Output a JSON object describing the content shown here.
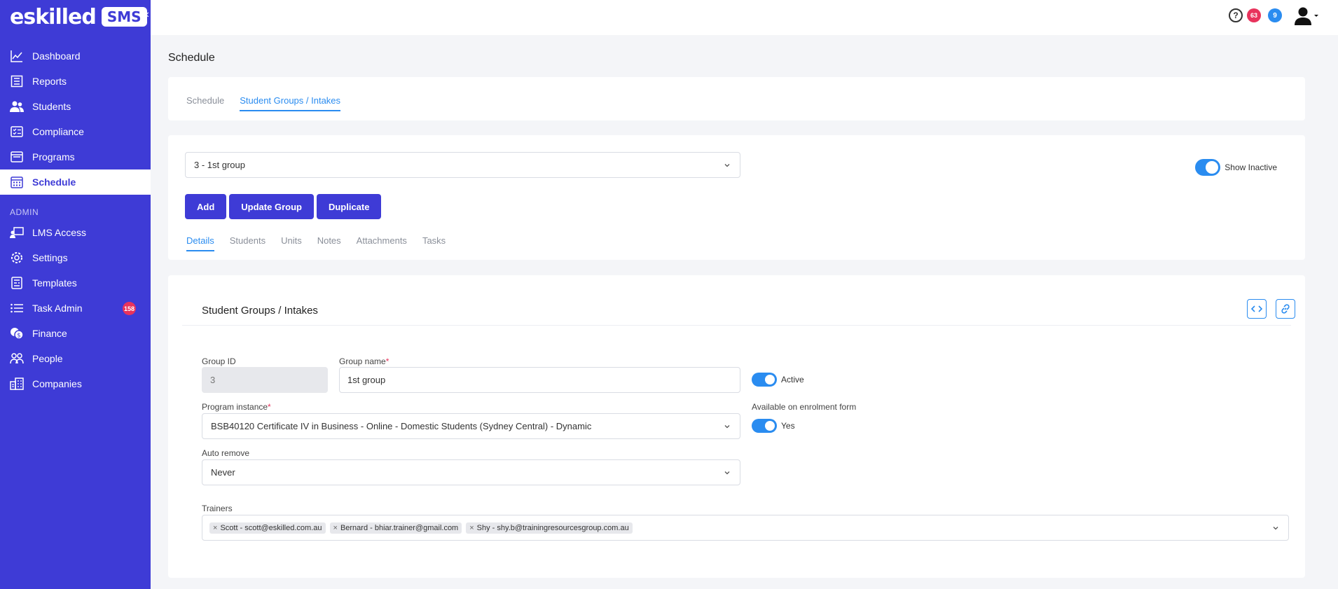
{
  "brand": {
    "logo_text": "eskilled",
    "badge": "SMS",
    "collapse_glyph": "«"
  },
  "nav": {
    "items": [
      {
        "label": "Dashboard",
        "icon": "chart-line-icon"
      },
      {
        "label": "Reports",
        "icon": "report-icon"
      },
      {
        "label": "Students",
        "icon": "users-icon"
      },
      {
        "label": "Compliance",
        "icon": "checklist-icon"
      },
      {
        "label": "Programs",
        "icon": "window-icon"
      },
      {
        "label": "Schedule",
        "icon": "calendar-icon",
        "active": true
      }
    ],
    "admin_label": "ADMIN",
    "admin_items": [
      {
        "label": "LMS Access",
        "icon": "presentation-icon"
      },
      {
        "label": "Settings",
        "icon": "gear-icon"
      },
      {
        "label": "Templates",
        "icon": "template-icon"
      },
      {
        "label": "Task Admin",
        "icon": "list-icon",
        "badge": "158"
      },
      {
        "label": "Finance",
        "icon": "coins-icon"
      },
      {
        "label": "People",
        "icon": "people-icon"
      },
      {
        "label": "Companies",
        "icon": "building-icon"
      }
    ]
  },
  "topbar": {
    "help": "?",
    "notif_red": "63",
    "notif_blue": "9"
  },
  "page": {
    "title": "Schedule",
    "tabs": [
      "Schedule",
      "Student Groups / Intakes"
    ],
    "active_tab": 1
  },
  "group": {
    "selected": "3 - 1st group",
    "show_inactive": "Show Inactive",
    "buttons": {
      "add": "Add",
      "update": "Update Group",
      "duplicate": "Duplicate"
    },
    "subtabs": [
      "Details",
      "Students",
      "Units",
      "Notes",
      "Attachments",
      "Tasks"
    ]
  },
  "details": {
    "title": "Student Groups / Intakes",
    "group_id_label": "Group ID",
    "group_id": "3",
    "group_name_label": "Group name",
    "group_name": "1st group",
    "active_label": "Active",
    "program_label": "Program instance",
    "program": "BSB40120 Certificate IV in Business - Online - Domestic Students (Sydney Central) - Dynamic",
    "available_label": "Available on enrolment form",
    "available_value": "Yes",
    "auto_remove_label": "Auto remove",
    "auto_remove": "Never",
    "trainers_label": "Trainers",
    "trainers": [
      "Scott - scott@eskilled.com.au",
      "Bernard - bhiar.trainer@gmail.com",
      "Shy - shy.b@trainingresourcesgroup.com.au"
    ],
    "required_mark": "*",
    "chip_remove": "×"
  },
  "colors": {
    "sidebar": "#3e3bd6",
    "accent": "#2a8cf0",
    "badge": "#e8335c"
  }
}
